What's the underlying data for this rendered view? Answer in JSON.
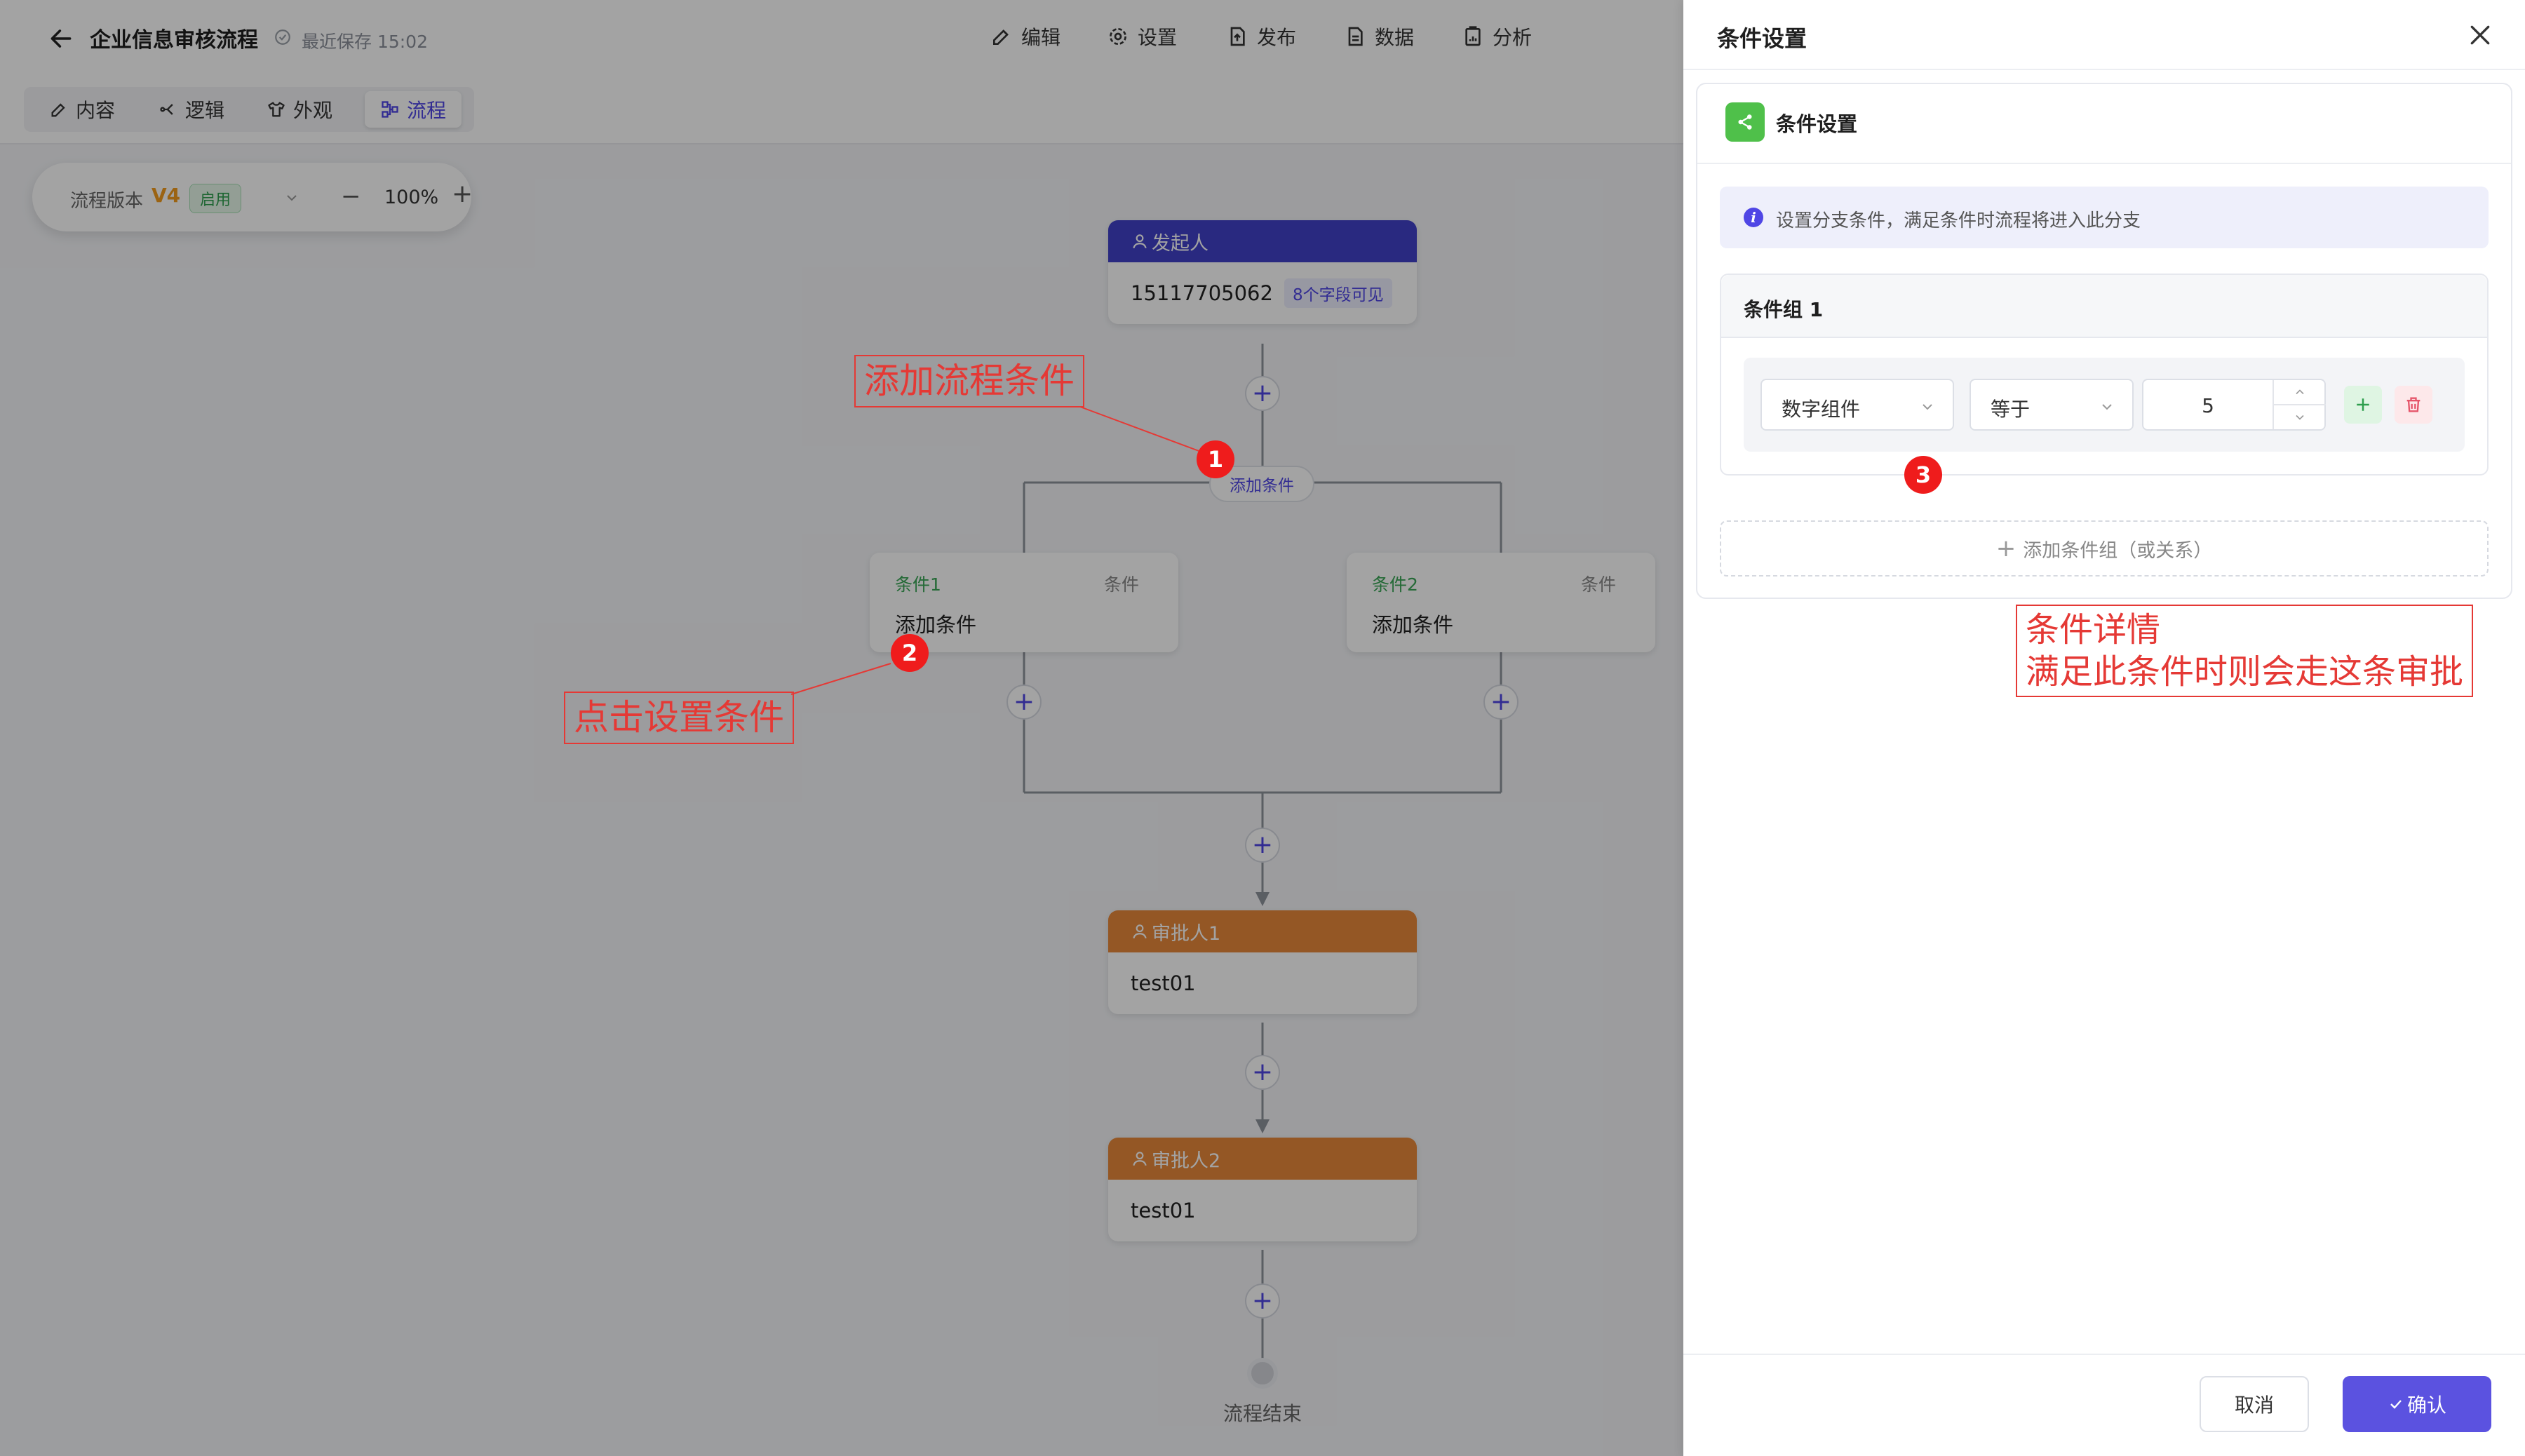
{
  "header": {
    "title": "企业信息审核流程",
    "save_status": "最近保存 15:02",
    "menu": [
      {
        "label": "编辑",
        "icon": "edit-icon"
      },
      {
        "label": "设置",
        "icon": "gear-icon"
      },
      {
        "label": "发布",
        "icon": "publish-icon"
      },
      {
        "label": "数据",
        "icon": "document-icon"
      },
      {
        "label": "分析",
        "icon": "analysis-icon"
      }
    ]
  },
  "tabs": [
    {
      "label": "内容",
      "icon": "edit-icon"
    },
    {
      "label": "逻辑",
      "icon": "logic-icon"
    },
    {
      "label": "外观",
      "icon": "shirt-icon"
    },
    {
      "label": "流程",
      "icon": "flow-icon",
      "active": true
    }
  ],
  "version_bar": {
    "label": "流程版本",
    "version": "V4",
    "status": "启用",
    "zoom": "100%",
    "minus": "−",
    "plus": "+"
  },
  "flow": {
    "initiator": {
      "title": "发起人",
      "value": "15117705062",
      "badge": "8个字段可见"
    },
    "add_condition_label": "添加条件",
    "conditions": [
      {
        "title": "条件1",
        "type": "条件",
        "text": "添加条件"
      },
      {
        "title": "条件2",
        "type": "条件",
        "text": "添加条件"
      }
    ],
    "approvers": [
      {
        "title": "审批人1",
        "value": "test01"
      },
      {
        "title": "审批人2",
        "value": "test01"
      }
    ],
    "end_label": "流程结束",
    "add_symbol": "+"
  },
  "annotations": {
    "a1": {
      "num": "1",
      "text": "添加流程条件"
    },
    "a2": {
      "num": "2",
      "text": "点击设置条件"
    },
    "a3": {
      "num": "3",
      "line1": "条件详情",
      "line2": "满足此条件时则会走这条审批"
    }
  },
  "drawer": {
    "title": "条件设置",
    "card_title": "条件设置",
    "info": "设置分支条件，满足条件时流程将进入此分支",
    "group_title": "条件组 1",
    "field_select": "数字组件",
    "operator_select": "等于",
    "value": "5",
    "add_group": "添加条件组（或关系）",
    "cancel": "取消",
    "confirm": "确认"
  },
  "colors": {
    "primary": "#4f46e5",
    "initiator_head": "#4040c8",
    "approver_head": "#e8893a",
    "annotation": "#e53935",
    "condition_title": "#3aa657"
  }
}
